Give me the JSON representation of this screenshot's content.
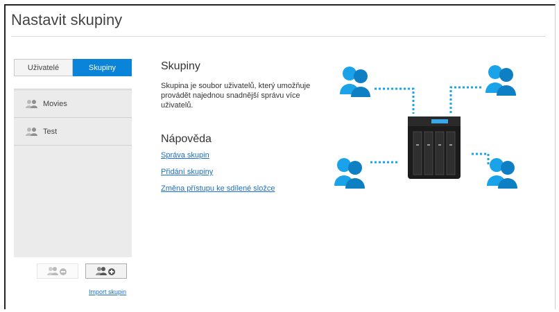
{
  "page": {
    "title": "Nastavit skupiny"
  },
  "tabs": {
    "users_label": "Uživatelé",
    "groups_label": "Skupiny",
    "active": "groups"
  },
  "groups_list": {
    "items": [
      {
        "label": "Movies",
        "icon": "group-icon"
      },
      {
        "label": "Test",
        "icon": "group-icon"
      }
    ]
  },
  "list_actions": {
    "remove_icon": "remove-group-icon",
    "add_icon": "add-group-icon",
    "import_label": "Import skupin"
  },
  "info": {
    "title": "Skupiny",
    "description": "Skupina je soubor uživatelů, který umožňuje provádět najednou snadnější správu více uživatelů."
  },
  "help": {
    "title": "Nápověda",
    "links": [
      {
        "label": "Správa skupin"
      },
      {
        "label": "Přidání skupiny"
      },
      {
        "label": "Změna přístupu ke sdílené složce"
      }
    ]
  },
  "colors": {
    "accent": "#0a84d8",
    "link": "#1a6fc4",
    "illustration_blue": "#1aa3e8",
    "device": "#1b1b1b"
  }
}
